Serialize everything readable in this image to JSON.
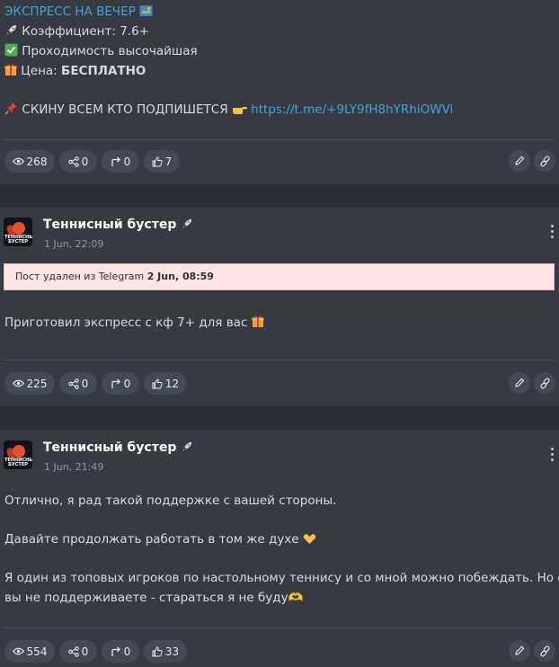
{
  "post1": {
    "lines": [
      "ЭКСПРЕСС НА ВЕЧЕР",
      "Коэффициент: 7.6+",
      "Проходимость высочайшая",
      "Цена: ",
      "БЕСПЛАТНО",
      "СКИНУ ВСЕМ КТО ПОДПИШЕТСЯ",
      "https://t.me/+9LY9fH8hYRhiOWVi"
    ],
    "stats": {
      "views": "268",
      "shares": "0",
      "forwards": "0",
      "likes": "7"
    }
  },
  "post2": {
    "channel": "Теннисный бустер",
    "date": "1 Jun, 22:09",
    "deleted_prefix": "Пост удален из Telegram ",
    "deleted_date": "2 Jun, 08:59",
    "text": "Приготовил экспресс с кф 7+ для вас",
    "stats": {
      "views": "225",
      "shares": "0",
      "forwards": "0",
      "likes": "12"
    }
  },
  "post3": {
    "channel": "Теннисный бустер",
    "date": "1 Jun, 21:49",
    "lines": [
      "Отлично, я рад такой поддержке с вашей стороны.",
      "Давайте продолжать работать в том же духе",
      "Я один из топовых игроков по настольному теннису и со мной можно побеждать. Но если",
      "вы не поддерживаете - стараться я не буду🫶"
    ],
    "stats": {
      "views": "554",
      "shares": "0",
      "forwards": "0",
      "likes": "33"
    }
  },
  "avatar_label": "ТЕННИСНЫЙ БУСТЕР",
  "icons": [
    "eye-icon",
    "share-icon",
    "forward-icon",
    "thumbs-up-icon",
    "edit-icon",
    "link-icon",
    "kebab-menu-icon",
    "rocket-icon",
    "check-icon",
    "gift-icon",
    "pin-icon",
    "pointing-hand-icon",
    "heart-hands-icon",
    "map-icon"
  ],
  "colors": {
    "background": "#2b2f37",
    "card": "#353a43",
    "link": "#3fa6d8",
    "deleted_bg": "#fde4e4",
    "pill": "#444a55"
  }
}
